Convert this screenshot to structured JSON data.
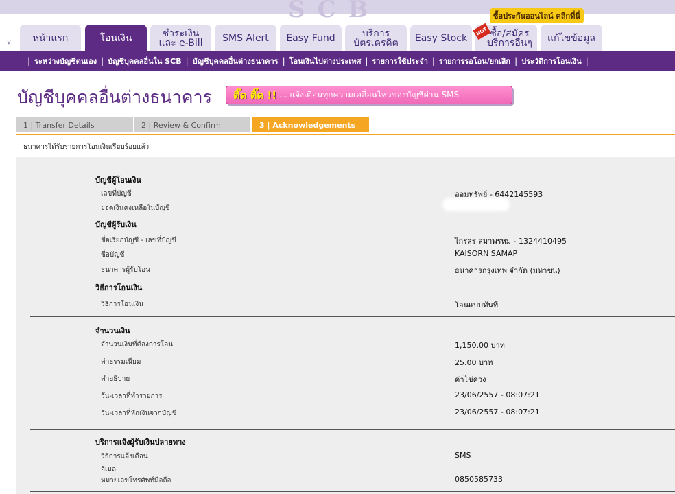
{
  "top": {
    "xl_label": "XI",
    "promo": "ซื้อประกันออนไลน์ คลิกที่นี่",
    "hot_badge": "HOT",
    "tabs": [
      {
        "label": "หน้าแรก"
      },
      {
        "label": "โอนเงิน"
      },
      {
        "label": "ชำระเงิน\nและ e-Bill"
      },
      {
        "label": "SMS Alert"
      },
      {
        "label": "Easy Fund"
      },
      {
        "label": "บริการ\nบัตรเครดิต"
      },
      {
        "label": "Easy Stock"
      },
      {
        "label": "ซื้อ/สมัคร\nบริการอื่นๆ"
      },
      {
        "label": "แก้ไขข้อมูล"
      }
    ]
  },
  "subnav": {
    "items": [
      "ระหว่างบัญชีตนเอง",
      "บัญชีบุคคลอื่นใน SCB",
      "บัญชีบุคคลอื่นต่างธนาคาร",
      "โอนเงินไปต่างประเทศ",
      "รายการใช้ประจำ",
      "รายการรอโอน/ยกเลิก",
      "ประวัติการโอนเงิน"
    ]
  },
  "page": {
    "title": "บัญชีบุคคลอื่นต่างธนาคาร",
    "sms_banner_bold": "ติ๊ด ติ๊ด !!",
    "sms_banner_text": "... แจ้งเตือนทุกความเคลื่อนไหวของบัญชีผ่าน SMS",
    "ack_message": "ธนาคารได้รับรายการโอนเงินเรียบร้อยแล้ว"
  },
  "steps": [
    {
      "label": "1 | Transfer Details"
    },
    {
      "label": "2 | Review & Confirm"
    },
    {
      "label": "3 | Acknowledgements"
    }
  ],
  "details": {
    "from_title": "บัญชีผู้โอนเงิน",
    "from_account_label": "เลขที่บัญชี",
    "from_account_value": "ออมทรัพย์ - 6442145593",
    "balance_label": "ยอดเงินคงเหลือในบัญชี",
    "to_title": "บัญชีผู้รับเงิน",
    "to_nick_label": "ชื่อเรียกบัญชี - เลขที่บัญชี",
    "to_nick_value": "ไกรสร สมาพรหม - 1324410495",
    "to_name_label": "ชื่อบัญชี",
    "to_name_value": "KAISORN SAMAP",
    "to_bank_label": "ธนาคารผู้รับโอน",
    "to_bank_value": "ธนาคารกรุงเทพ จำกัด (มหาชน)",
    "method_title": "วิธีการโอนเงิน",
    "method_label": "วิธีการโอนเงิน",
    "method_value": "โอนแบบทันที",
    "amount_title": "จำนวนเงิน",
    "amount_label": "จำนวนเงินที่ต้องการโอน",
    "amount_value": "1,150.00 บาท",
    "fee_label": "ค่าธรรมเนียม",
    "fee_value": "25.00  บาท",
    "desc_label": "คำอธิบาย",
    "desc_value": "ค่าไข่ควง",
    "datetime_label": "วัน-เวลาที่ทำรายการ",
    "datetime_value": "23/06/2557 - 08:07:21",
    "debit_label": "วัน-เวลาที่หักเงินจากบัญชี",
    "debit_value": "23/06/2557 - 08:07:21",
    "notify_title": "บริการแจ้งผู้รับเงินปลายทาง",
    "notify_method_label": "วิธีการแจ้งเตือน",
    "notify_method_value": "SMS",
    "email_label": "อีเมล",
    "phone_label": "หมายเลขโทรศัพท์มือถือ",
    "phone_value": "0850585733"
  },
  "colors": {
    "brand_purple": "#5d2b84",
    "step_active": "#f5a623",
    "tab_inactive": "#e4dfef"
  }
}
